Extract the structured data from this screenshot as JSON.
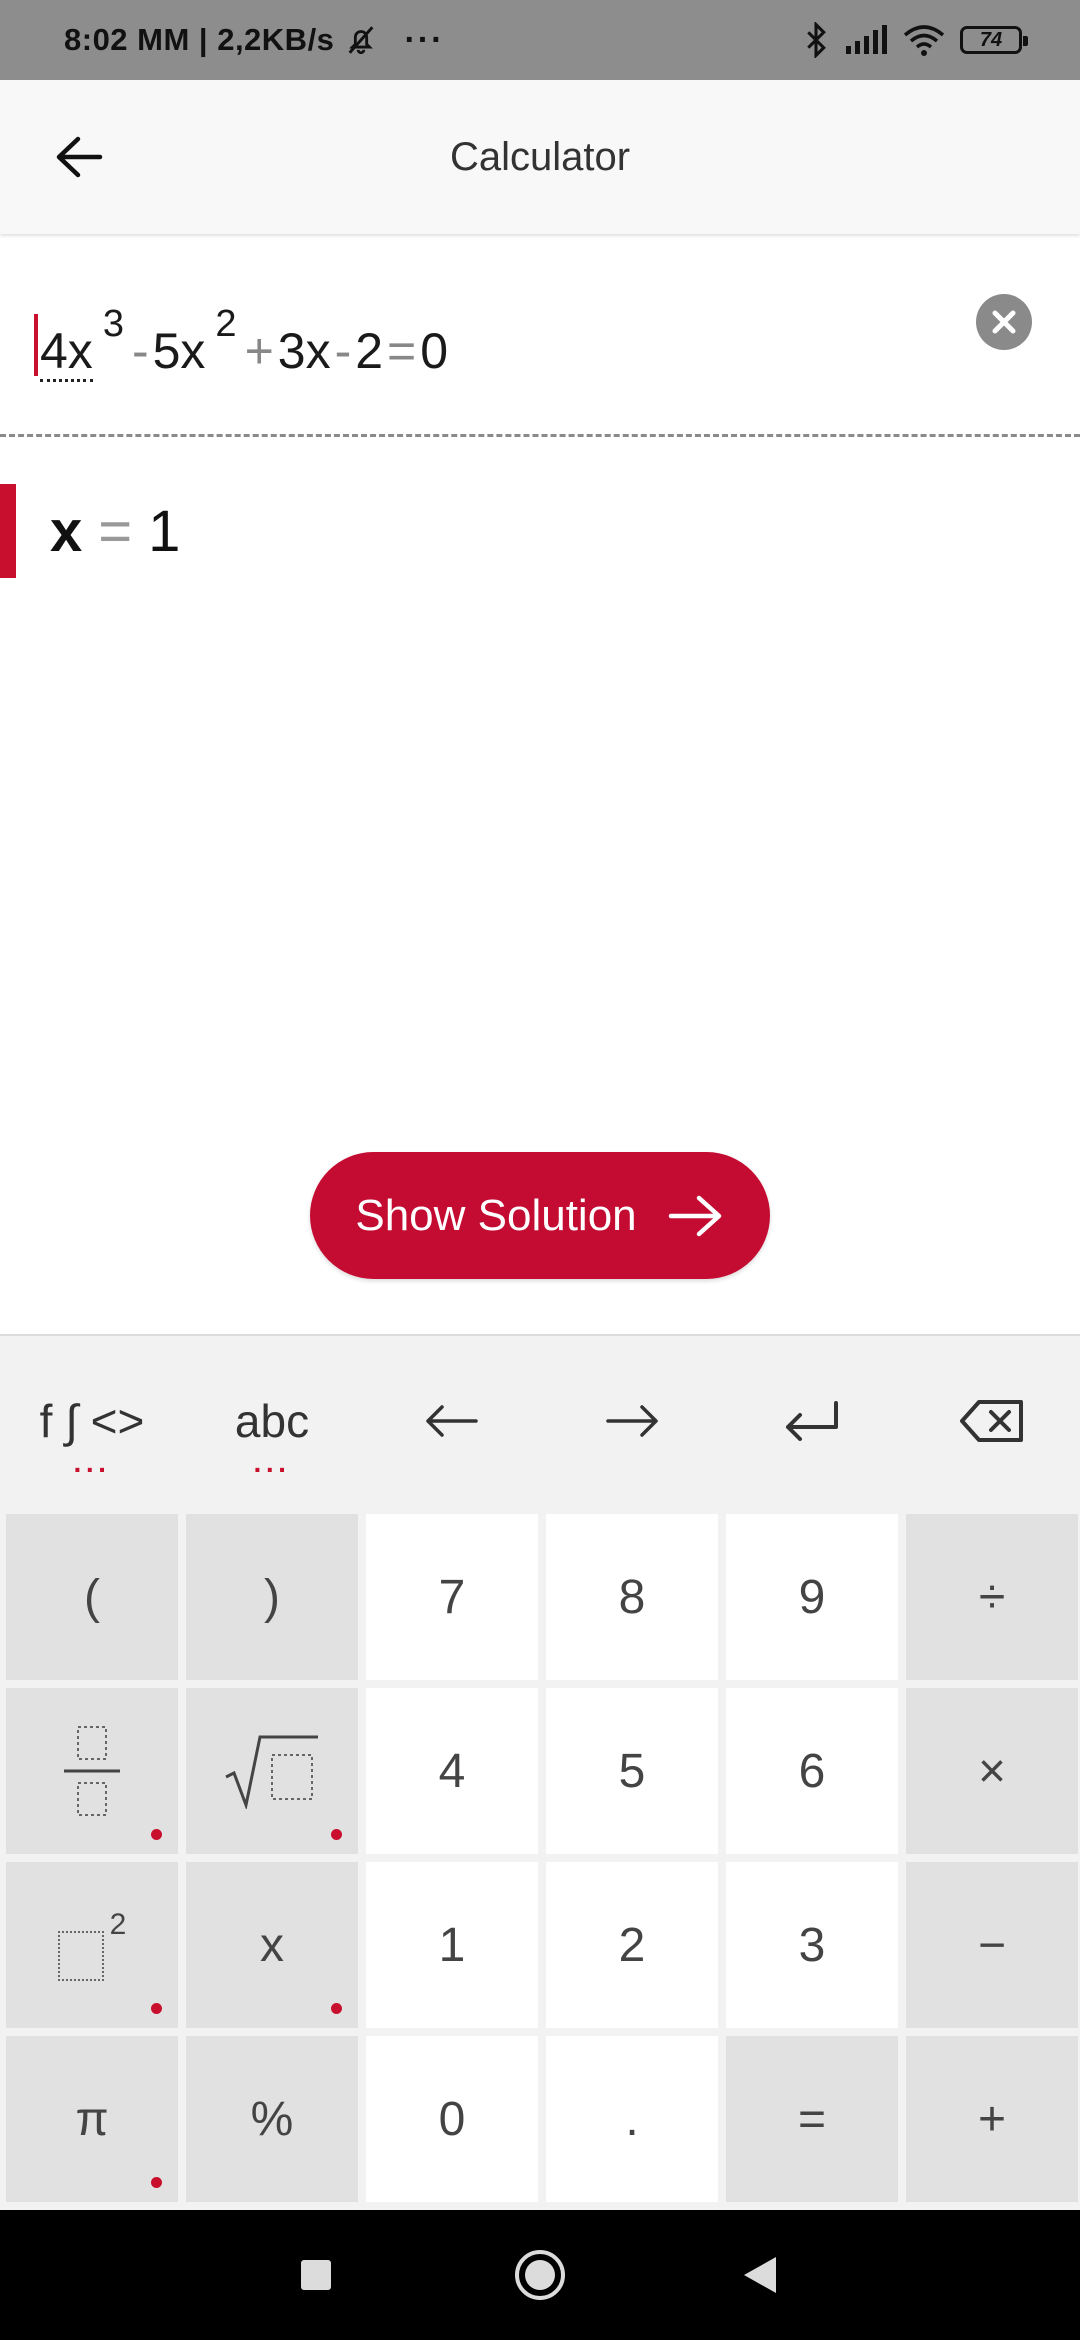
{
  "status_bar": {
    "time_text": "8:02 MM | 2,2KB/s",
    "more": "···",
    "battery_level": "74"
  },
  "app_bar": {
    "title": "Calculator"
  },
  "expression": {
    "t1": "4x",
    "e1": "3",
    "op1": "-",
    "t2": "5x",
    "e2": "2",
    "op2": "+",
    "t3": "3x",
    "op3": "-",
    "t4": "2",
    "op4": "=",
    "t5": "0"
  },
  "result": {
    "variable": "x",
    "equals": "=",
    "value": "1"
  },
  "show_solution": {
    "label": "Show Solution"
  },
  "keyboard": {
    "top": {
      "functions": "f ∫ <>",
      "letters": "abc",
      "dots": "···"
    },
    "keys": {
      "lparen": "(",
      "rparen": ")",
      "k7": "7",
      "k8": "8",
      "k9": "9",
      "div": "÷",
      "k4": "4",
      "k5": "5",
      "k6": "6",
      "mul": "×",
      "sq_exp": "2",
      "x": "x",
      "k1": "1",
      "k2": "2",
      "k3": "3",
      "minus": "−",
      "pi": "π",
      "percent": "%",
      "k0": "0",
      "dot": ".",
      "equals": "=",
      "plus": "+"
    }
  },
  "colors": {
    "accent": "#c40c32",
    "keyboard_bg": "#f2f2f2",
    "key_gray": "#e1e1e1"
  }
}
